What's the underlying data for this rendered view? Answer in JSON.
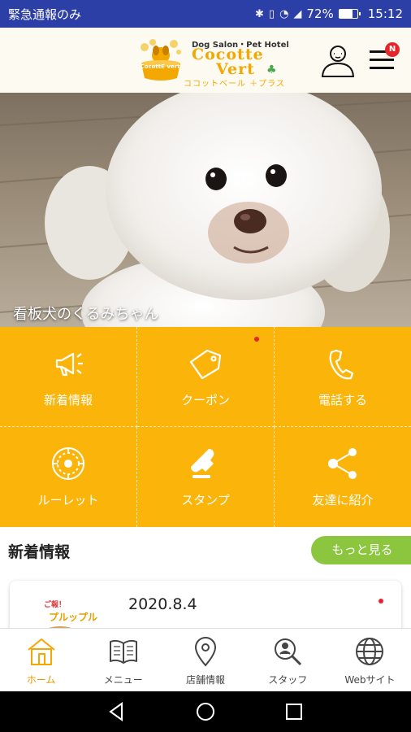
{
  "status_bar": {
    "left_text": "緊急通報のみ",
    "battery": "72%",
    "battery_level": 0.72,
    "time": "15:12"
  },
  "header": {
    "logo": {
      "tagline": "Dog Salon・Pet Hotel",
      "name_line1": "Cocotte",
      "name_line2": "Vert",
      "kana": "ココットベール ＋プラス",
      "badge": "CocottE vert"
    }
  },
  "hero": {
    "caption": "看板犬のくるみちゃん"
  },
  "menu_grid": [
    {
      "label": "新着情報",
      "icon": "megaphone-icon",
      "dot": false
    },
    {
      "label": "クーポン",
      "icon": "coupon-icon",
      "dot": true
    },
    {
      "label": "電話する",
      "icon": "phone-icon",
      "dot": false
    },
    {
      "label": "ルーレット",
      "icon": "roulette-icon",
      "dot": false
    },
    {
      "label": "スタンプ",
      "icon": "stamp-icon",
      "dot": false
    },
    {
      "label": "友達に紹介",
      "icon": "share-icon",
      "dot": false
    }
  ],
  "news": {
    "title": "新着情報",
    "more_label": "もっと見る",
    "items": [
      {
        "date": "2020.8.4",
        "thumb_text_1": "ご報！",
        "thumb_text_2": "プルップル"
      }
    ]
  },
  "bottom_nav": [
    {
      "label": "ホーム",
      "icon": "home-icon",
      "active": true
    },
    {
      "label": "メニュー",
      "icon": "menu-book-icon",
      "active": false
    },
    {
      "label": "店舗情報",
      "icon": "map-pin-icon",
      "active": false
    },
    {
      "label": "スタッフ",
      "icon": "staff-search-icon",
      "active": false
    },
    {
      "label": "Webサイト",
      "icon": "globe-icon",
      "active": false
    }
  ],
  "colors": {
    "status_bar": "#2c3fa6",
    "grid_orange": "#fbb40a",
    "more_green": "#8cc63f",
    "badge_red": "#e5252a",
    "active_nav": "#e09a00"
  }
}
